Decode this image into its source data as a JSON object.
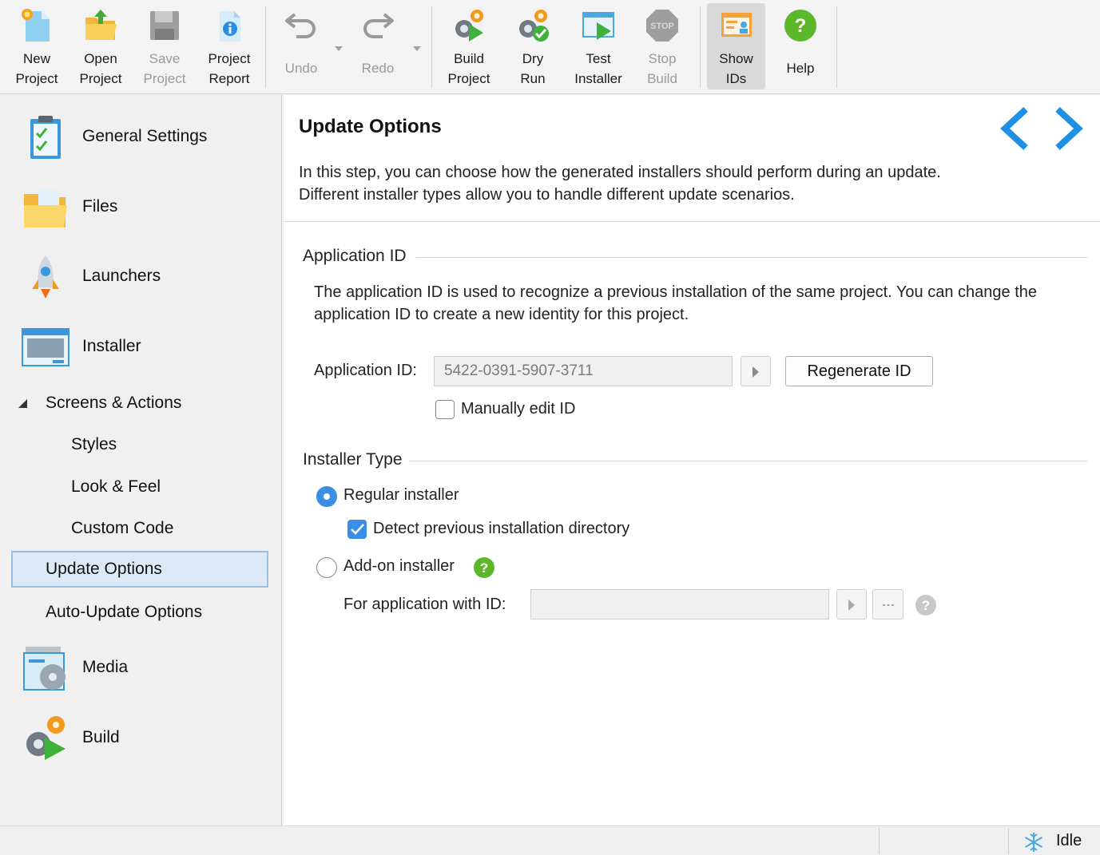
{
  "toolbar": {
    "new_project": {
      "line1": "New",
      "line2": "Project"
    },
    "open_project": {
      "line1": "Open",
      "line2": "Project"
    },
    "save_project": {
      "line1": "Save",
      "line2": "Project"
    },
    "project_report": {
      "line1": "Project",
      "line2": "Report"
    },
    "undo": {
      "label": "Undo"
    },
    "redo": {
      "label": "Redo"
    },
    "build_project": {
      "line1": "Build",
      "line2": "Project"
    },
    "dry_run": {
      "line1": "Dry",
      "line2": "Run"
    },
    "test_installer": {
      "line1": "Test",
      "line2": "Installer"
    },
    "stop_build": {
      "line1": "Stop",
      "line2": "Build"
    },
    "show_ids": {
      "line1": "Show",
      "line2": "IDs"
    },
    "help": {
      "label": "Help"
    }
  },
  "sidebar": {
    "general_settings": "General Settings",
    "files": "Files",
    "launchers": "Launchers",
    "installer": "Installer",
    "screens_actions": "Screens & Actions",
    "styles": "Styles",
    "look_feel": "Look & Feel",
    "custom_code": "Custom Code",
    "update_options": "Update Options",
    "auto_update_options": "Auto-Update Options",
    "media": "Media",
    "build": "Build"
  },
  "main": {
    "title": "Update Options",
    "description_line1": "In this step, you can choose how the generated installers should perform during an update.",
    "description_line2": "Different installer types allow you to handle different update scenarios.",
    "application_id_section": {
      "title": "Application ID",
      "text_line1": "The application ID is used to recognize a previous installation of the same project. You can change the",
      "text_line2": "application ID to create a new identity for this project.",
      "field_label": "Application ID:",
      "field_value": "5422-0391-5907-3711",
      "regenerate_label": "Regenerate ID",
      "manual_edit_label": "Manually edit ID",
      "manual_edit_checked": false
    },
    "installer_type_section": {
      "title": "Installer Type",
      "regular_label": "Regular installer",
      "regular_selected": true,
      "detect_label": "Detect previous installation directory",
      "detect_checked": true,
      "addon_label": "Add-on installer",
      "addon_selected": false,
      "for_app_label": "For application with ID:",
      "for_app_value": ""
    }
  },
  "status": {
    "text": "Idle",
    "icon": "snowflake-icon"
  },
  "colors": {
    "accent": "#3a8ee6",
    "nav_arrow": "#1e90e6",
    "selected_bg": "#dde9f6",
    "help_green": "#5cb82a"
  }
}
